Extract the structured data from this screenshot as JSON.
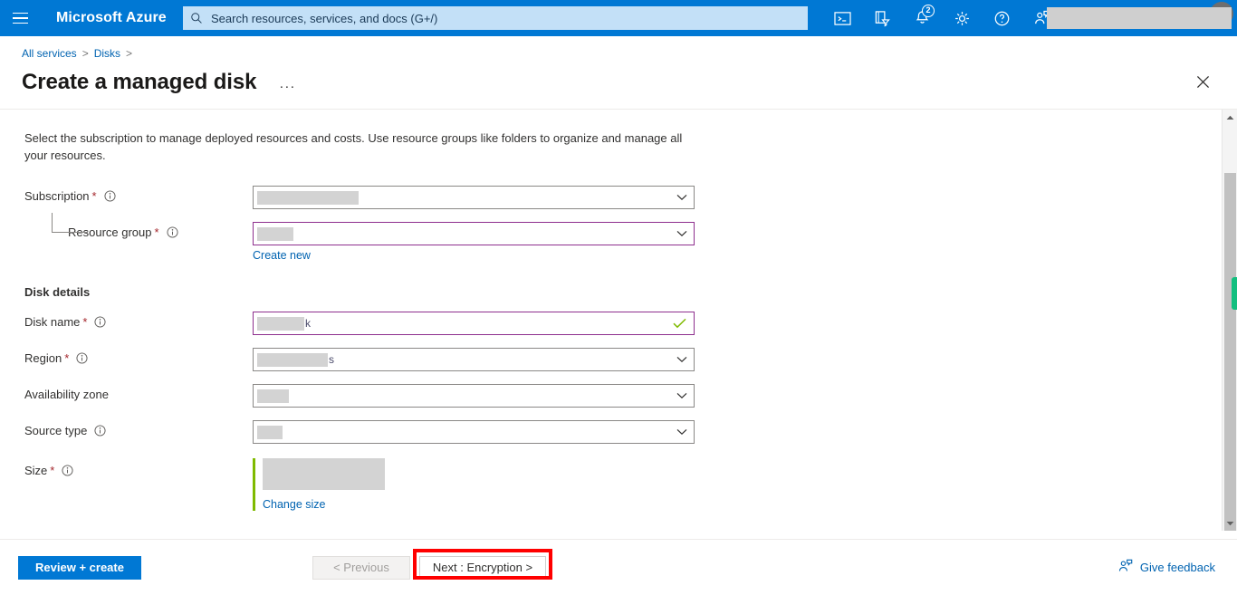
{
  "topbar": {
    "brand": "Microsoft Azure",
    "menu_icon": "hamburger-icon",
    "search": {
      "placeholder": "Search resources, services, and docs (G+/)",
      "value": "",
      "icon": "search-icon"
    },
    "icons": [
      {
        "name": "cloud-shell-icon",
        "label": "Cloud Shell"
      },
      {
        "name": "directories-subscriptions-icon",
        "label": "Directories + subscriptions"
      },
      {
        "name": "notifications-bell-icon",
        "label": "Notifications",
        "badge": "2"
      },
      {
        "name": "settings-gear-icon",
        "label": "Settings"
      },
      {
        "name": "help-question-icon",
        "label": "Help"
      },
      {
        "name": "feedback-person-icon",
        "label": "Feedback"
      }
    ],
    "account_redacted": true,
    "accent_color": "#0078d4"
  },
  "breadcrumb": {
    "items": [
      {
        "label": "All services",
        "link": true
      },
      {
        "label": "Disks",
        "link": true
      }
    ],
    "separator": ">"
  },
  "header": {
    "title": "Create a managed disk",
    "more_menu": "···",
    "close_icon": "close-icon"
  },
  "form": {
    "description": "Select the subscription to manage deployed resources and costs. Use resource groups like folders to organize and manage all your resources.",
    "project_fields": [
      {
        "label": "Subscription",
        "required": true,
        "has_info": true,
        "control": "dropdown",
        "value_redacted": true,
        "redact_width": 112,
        "focused": false,
        "indent": false
      },
      {
        "label": "Resource group",
        "required": true,
        "has_info": true,
        "control": "dropdown",
        "value_redacted": true,
        "redact_width": 40,
        "focused": true,
        "indent": true,
        "sublink": "Create new"
      }
    ],
    "section_heading": "Disk details",
    "disk_fields": [
      {
        "label": "Disk name",
        "required": true,
        "has_info": true,
        "control": "text",
        "value_redacted": true,
        "redact_width": 52,
        "trailing_char": "k",
        "focused": true,
        "valid": true
      },
      {
        "label": "Region",
        "required": true,
        "has_info": true,
        "control": "dropdown",
        "value_redacted": true,
        "redact_width": 78,
        "trailing_char": "s",
        "focused": false
      },
      {
        "label": "Availability zone",
        "required": false,
        "has_info": false,
        "control": "dropdown",
        "value_redacted": true,
        "redact_width": 35,
        "focused": false
      },
      {
        "label": "Source type",
        "required": false,
        "has_info": true,
        "control": "dropdown",
        "value_redacted": true,
        "redact_width": 28,
        "focused": false
      }
    ],
    "size_field": {
      "label": "Size",
      "required": true,
      "has_info": true,
      "value_redacted": true,
      "change_link": "Change size",
      "accent_color": "#7fba00"
    }
  },
  "scrollbar": {
    "up_arrow_icon": "chevron-up-icon",
    "down_arrow_icon": "chevron-down-icon",
    "indicator_color": "#13bf7f"
  },
  "footer": {
    "review_create": "Review + create",
    "previous": "< Previous",
    "next": "Next : Encryption >",
    "next_highlighted": true,
    "highlight_color": "#ff0000",
    "feedback": "Give feedback",
    "feedback_icon": "feedback-person-icon"
  }
}
